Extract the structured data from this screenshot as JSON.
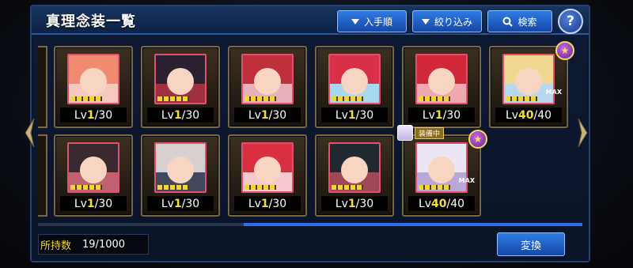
{
  "header": {
    "title": "真理念装一覧",
    "sort_label": "入手順",
    "filter_label": "絞り込み",
    "search_label": "検索",
    "help_label": "?"
  },
  "cards": [
    {
      "lv_label": "Lv",
      "lv_current": "1",
      "lv_max": "/30",
      "hair": "#f08a70",
      "bg": "#f6c8c0"
    },
    {
      "lv_label": "Lv",
      "lv_current": "1",
      "lv_max": "/30",
      "hair": "#2a2030",
      "bg": "#a03040"
    },
    {
      "lv_label": "Lv",
      "lv_current": "1",
      "lv_max": "/30",
      "hair": "#c0303c",
      "bg": "#e8b0b8"
    },
    {
      "lv_label": "Lv",
      "lv_current": "1",
      "lv_max": "/30",
      "hair": "#d83048",
      "bg": "#a8d8f0"
    },
    {
      "lv_label": "Lv",
      "lv_current": "1",
      "lv_max": "/30",
      "hair": "#d02838",
      "bg": "#f0a8b0"
    },
    {
      "lv_label": "Lv",
      "lv_current": "40",
      "lv_max": "/40",
      "hair": "#f0d890",
      "bg": "#b8d8f0",
      "badge": true,
      "max": "MAX"
    },
    {
      "lv_label": "Lv",
      "lv_current": "1",
      "lv_max": "/30",
      "hair": "#3a2a30",
      "bg": "#c06070"
    },
    {
      "lv_label": "Lv",
      "lv_current": "1",
      "lv_max": "/30",
      "hair": "#d8d0d0",
      "bg": "#404860"
    },
    {
      "lv_label": "Lv",
      "lv_current": "1",
      "lv_max": "/30",
      "hair": "#d83040",
      "bg": "#f8c8d0"
    },
    {
      "lv_label": "Lv",
      "lv_current": "1",
      "lv_max": "/30",
      "hair": "#202830",
      "bg": "#a04858"
    },
    {
      "lv_label": "Lv",
      "lv_current": "40",
      "lv_max": "/40",
      "hair": "#ece6f4",
      "bg": "#b8a8d8",
      "badge": true,
      "max": "MAX",
      "equipped": "装備中"
    }
  ],
  "badge_glyph": "★",
  "footer": {
    "count_label": "所持数",
    "count_value": "19/1000",
    "convert_label": "変換"
  },
  "colors": {
    "accent": "#2f7be3",
    "level_highlight": "#f4e032",
    "frame": "#7a6544"
  }
}
